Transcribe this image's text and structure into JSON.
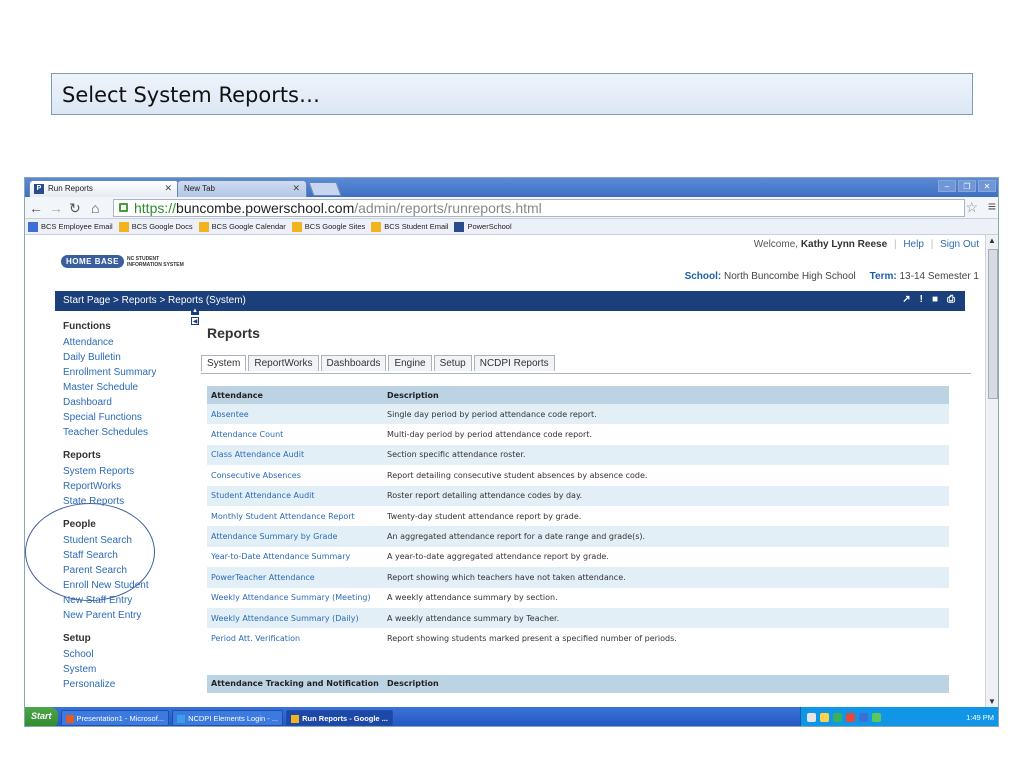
{
  "slide": {
    "callout_text": "Select System Reports…"
  },
  "browser": {
    "tabs": [
      {
        "title": "Run Reports",
        "favicon": "P"
      },
      {
        "title": "New Tab"
      }
    ],
    "url_protocol": "https://",
    "url_host": "buncombe.powerschool.com",
    "url_path": "/admin/reports/runreports.html",
    "bookmarks": [
      {
        "label": "BCS Employee Email",
        "color": "#3b6fd6"
      },
      {
        "label": "BCS Google Docs",
        "color": "#f2b320"
      },
      {
        "label": "BCS Google Calendar",
        "color": "#f2b320"
      },
      {
        "label": "BCS Google Sites",
        "color": "#f2b320"
      },
      {
        "label": "BCS Student Email",
        "color": "#f2b320"
      },
      {
        "label": "PowerSchool",
        "color": "#2b4c8c"
      }
    ]
  },
  "header": {
    "welcome_prefix": "Welcome,",
    "user_name": "Kathy Lynn Reese",
    "help_label": "Help",
    "signout_label": "Sign Out",
    "logo_main": "HOME BASE",
    "logo_line1": "NC STUDENT",
    "logo_line2": "INFORMATION SYSTEM",
    "school_label": "School:",
    "school_value": "North Buncombe High School",
    "term_label": "Term:",
    "term_value": "13-14 Semester 1"
  },
  "breadcrumb": "Start Page > Reports > Reports (System)",
  "sidebar": {
    "sections": [
      {
        "title": "Functions",
        "items": [
          "Attendance",
          "Daily Bulletin",
          "Enrollment Summary",
          "Master Schedule",
          "Dashboard",
          "Special Functions",
          "Teacher Schedules"
        ]
      },
      {
        "title": "Reports",
        "items": [
          "System Reports",
          "ReportWorks",
          "State Reports"
        ]
      },
      {
        "title": "People",
        "items": [
          "Student Search",
          "Staff Search",
          "Parent Search",
          "Enroll New Student",
          "New Staff Entry",
          "New Parent Entry"
        ]
      },
      {
        "title": "Setup",
        "items": [
          "School",
          "System",
          "Personalize"
        ]
      }
    ]
  },
  "main": {
    "title": "Reports",
    "tabs": [
      "System",
      "ReportWorks",
      "Dashboards",
      "Engine",
      "Setup",
      "NCDPI Reports"
    ],
    "table": {
      "col1": "Attendance",
      "col2": "Description",
      "rows": [
        {
          "name": "Absentee",
          "desc": "Single day period by period attendance code report."
        },
        {
          "name": "Attendance Count",
          "desc": "Multi-day period by period attendance code report."
        },
        {
          "name": "Class Attendance Audit",
          "desc": "Section specific attendance roster."
        },
        {
          "name": "Consecutive Absences",
          "desc": "Report detailing consecutive student absences by absence code."
        },
        {
          "name": "Student Attendance Audit",
          "desc": "Roster report detailing attendance codes by day."
        },
        {
          "name": "Monthly Student Attendance Report",
          "desc": "Twenty-day student attendance report by grade."
        },
        {
          "name": "Attendance Summary by Grade",
          "desc": "An aggregated attendance report for a date range and grade(s)."
        },
        {
          "name": "Year-to-Date Attendance Summary",
          "desc": "A year-to-date aggregated attendance report by grade."
        },
        {
          "name": "PowerTeacher Attendance",
          "desc": "Report showing which teachers have not taken attendance."
        },
        {
          "name": "Weekly Attendance Summary (Meeting)",
          "desc": "A weekly attendance summary by section."
        },
        {
          "name": "Weekly Attendance Summary (Daily)",
          "desc": "A weekly attendance summary by Teacher."
        },
        {
          "name": "Period Att. Verification",
          "desc": "Report showing students marked present a specified number of periods."
        }
      ],
      "section2_col1": "Attendance Tracking and Notification",
      "section2_col2": "Description"
    }
  },
  "taskbar": {
    "start_label": "Start",
    "tasks": [
      "Presentation1 - Microsof...",
      "NCDPI Elements Login - ...",
      "Run Reports - Google ..."
    ],
    "clock": "1:49 PM"
  }
}
